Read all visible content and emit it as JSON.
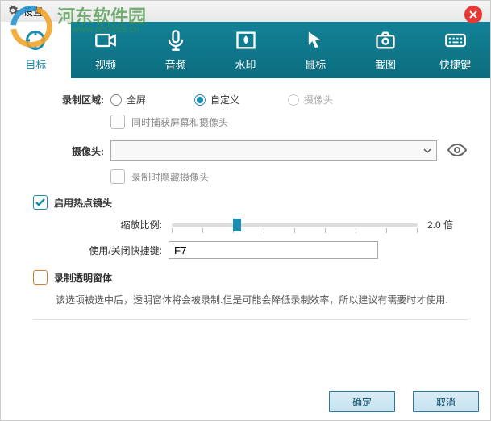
{
  "window": {
    "title": "设置"
  },
  "watermark": {
    "text": "河东软件园",
    "sub": "www.pc0359.cn"
  },
  "tabs": [
    {
      "label": "目标"
    },
    {
      "label": "视频"
    },
    {
      "label": "音频"
    },
    {
      "label": "水印"
    },
    {
      "label": "鼠标"
    },
    {
      "label": "截图"
    },
    {
      "label": "快捷键"
    }
  ],
  "recording": {
    "label": "录制区域:",
    "fullscreen": "全屏",
    "custom": "自定义",
    "webcam": "摄像头",
    "both_check": "同时捕获屏幕和摄像头"
  },
  "camera": {
    "label": "摄像头:",
    "hide_check": "录制时隐藏摄像头"
  },
  "hotspot": {
    "enable": "启用热点镜头",
    "zoom_label": "缩放比例:",
    "zoom_value": "2.0 倍",
    "hotkey_label": "使用/关闭快捷键:",
    "hotkey_value": "F7"
  },
  "transparent": {
    "label": "录制透明窗体",
    "desc": "该选项被选中后，透明窗体将会被录制.但是可能会降低录制效率，所以建议有需要时才使用."
  },
  "buttons": {
    "ok": "确定",
    "cancel": "取消"
  }
}
